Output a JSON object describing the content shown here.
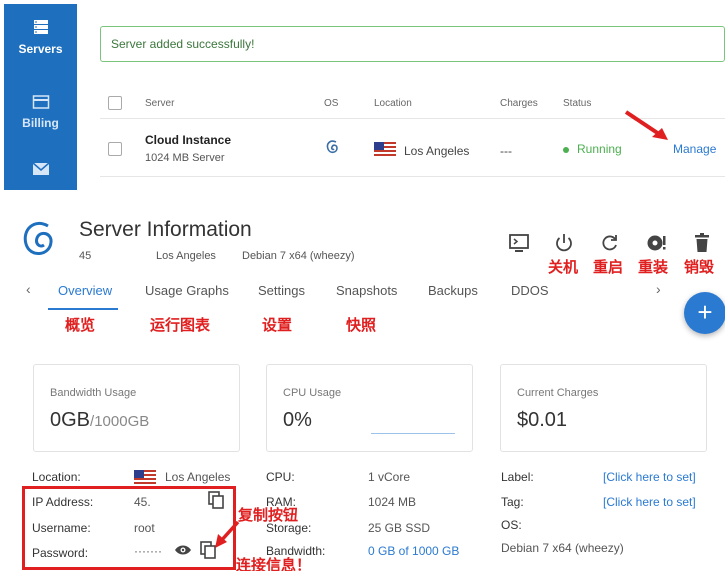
{
  "sidebar": {
    "items": [
      {
        "label": "Servers"
      },
      {
        "label": "Billing"
      },
      {
        "label": ""
      }
    ]
  },
  "alert": {
    "message": "Server added successfully!"
  },
  "table": {
    "headers": {
      "server": "Server",
      "os": "OS",
      "location": "Location",
      "charges": "Charges",
      "status": "Status"
    },
    "rows": [
      {
        "name": "Cloud Instance",
        "plan": "1024 MB Server",
        "location": "Los Angeles",
        "charges": "---",
        "status": "Running",
        "action": "Manage"
      }
    ]
  },
  "server": {
    "title": "Server Information",
    "meta": {
      "id": "45",
      "location": "Los Angeles",
      "os": "Debian 7 x64 (wheezy)"
    },
    "actions": [
      {
        "icon": "console-icon",
        "label": ""
      },
      {
        "icon": "power-icon",
        "label": "关机"
      },
      {
        "icon": "restart-icon",
        "label": "重启"
      },
      {
        "icon": "reinstall-icon",
        "label": "重装"
      },
      {
        "icon": "trash-icon",
        "label": "销毁"
      }
    ],
    "tabs": [
      "Overview",
      "Usage Graphs",
      "Settings",
      "Snapshots",
      "Backups",
      "DDOS"
    ],
    "tab_labels_zh": [
      "概览",
      "运行图表",
      "设置",
      "快照"
    ],
    "cards": {
      "bandwidth": {
        "title": "Bandwidth Usage",
        "value": "0GB",
        "suffix": "/1000GB"
      },
      "cpu": {
        "title": "CPU Usage",
        "value": "0%"
      },
      "charges": {
        "title": "Current Charges",
        "value": "$0.01"
      }
    },
    "details": {
      "location_label": "Location:",
      "location_value": "Los Angeles",
      "ip_label": "IP Address:",
      "ip_value": "45.",
      "username_label": "Username:",
      "username_value": "root",
      "password_label": "Password:",
      "password_value": "·······",
      "cpu_label": "CPU:",
      "cpu_value": "1 vCore",
      "ram_label": "RAM:",
      "ram_value": "1024 MB",
      "storage_label": "Storage:",
      "storage_value": "25 GB SSD",
      "bandwidth_label": "Bandwidth:",
      "bandwidth_value": "0 GB of 1000 GB",
      "label_label": "Label:",
      "label_value": "[Click here to set]",
      "tag_label": "Tag:",
      "tag_value": "[Click here to set]",
      "os_label": "OS:",
      "os_value": "Debian 7 x64 (wheezy)"
    },
    "annotations": {
      "copy_button": "复制按钮",
      "connection_info": "连接信息！"
    }
  },
  "colors": {
    "sidebar": "#1f6fbf",
    "accent": "#2a7ad2",
    "annotation": "#e02020",
    "running": "#4caf50"
  }
}
